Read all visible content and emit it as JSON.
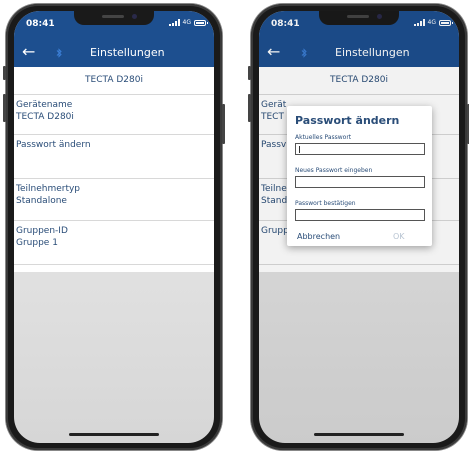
{
  "status": {
    "time": "08:41",
    "network": "4G"
  },
  "app": {
    "title": "Einstellungen"
  },
  "device": {
    "header": "TECTA D280i"
  },
  "settings": {
    "name_label": "Gerätename",
    "name_value": "TECTA D280i",
    "password_label": "Passwort ändern",
    "type_label": "Teilnehmertyp",
    "type_value": "Standalone",
    "group_label": "Gruppen-ID",
    "group_value": "Gruppe 1"
  },
  "background_truncated": {
    "name_label": "Gerät",
    "name_value": "TECT",
    "password_label": "Passv",
    "type_label": "Teilne",
    "type_value": "Stand",
    "group_label": "Grupp"
  },
  "dialog": {
    "title": "Passwort ändern",
    "current_label": "Aktuelles Passwort",
    "new_label": "Neues Passwort eingeben",
    "confirm_label": "Passwort bestätigen",
    "cancel_label": "Abbrechen",
    "ok_label": "OK"
  },
  "colors": {
    "header_bg": "#1d4f8f",
    "text_blue": "#2a4d78",
    "ok_disabled": "#b8c4d2",
    "bluetooth_icon": "#3b7fd6"
  },
  "icons": [
    "back-arrow-icon",
    "bluetooth-icon",
    "signal-icon",
    "battery-icon"
  ]
}
